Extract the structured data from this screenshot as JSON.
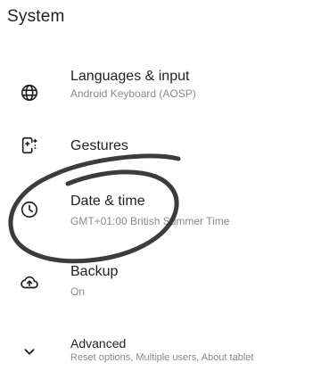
{
  "header": {
    "title": "System"
  },
  "items": [
    {
      "icon": "globe-icon",
      "label": "Languages & input",
      "summary": "Android Keyboard (AOSP)"
    },
    {
      "icon": "gestures-icon",
      "label": "Gestures",
      "summary": ""
    },
    {
      "icon": "clock-icon",
      "label": "Date & time",
      "summary": "GMT+01:00 British Summer Time"
    },
    {
      "icon": "cloud-upload-icon",
      "label": "Backup",
      "summary": "On"
    },
    {
      "icon": "chevron-down-icon",
      "label": "Advanced",
      "summary": "Reset options, Multiple users, About tablet"
    }
  ],
  "colors": {
    "text_primary": "#202124",
    "text_secondary": "#8a8a8a",
    "annotation_stroke": "#3c3c3c"
  }
}
